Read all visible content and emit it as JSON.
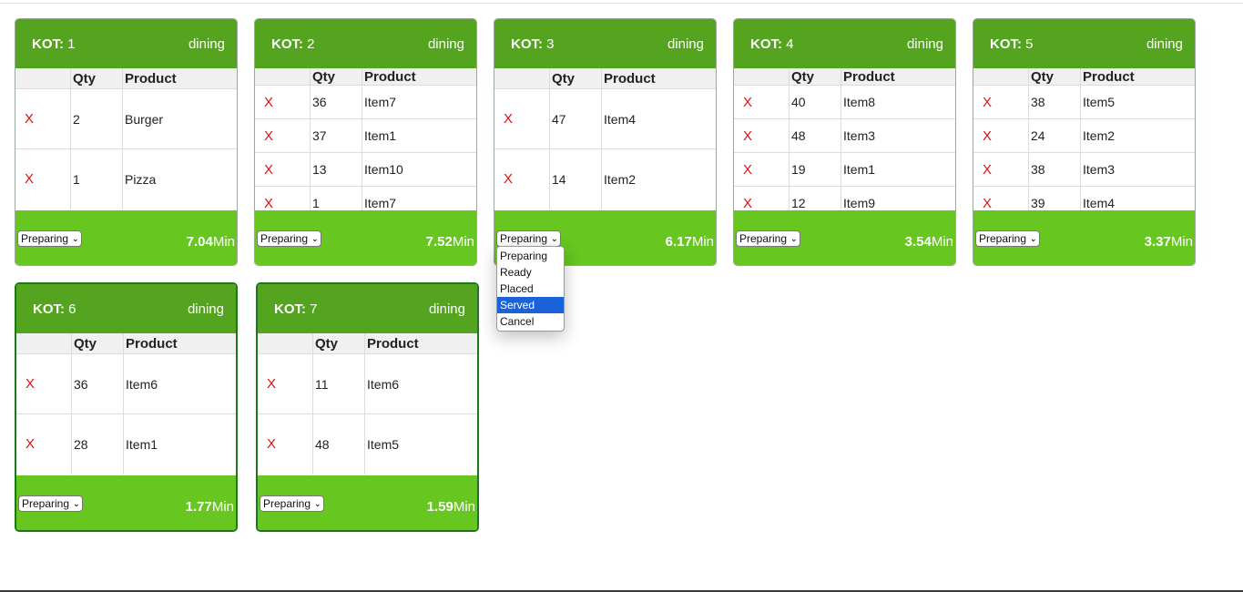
{
  "kot_label": "KOT:",
  "columns": {
    "qty": "Qty",
    "product": "Product"
  },
  "remove_symbol": "X",
  "minute_unit": "Min",
  "cards": [
    {
      "number": "1",
      "type": "dining",
      "status": "Preparing",
      "time": "7.04",
      "items": [
        {
          "qty": "2",
          "product": "Burger"
        },
        {
          "qty": "1",
          "product": "Pizza"
        }
      ]
    },
    {
      "number": "2",
      "type": "dining",
      "status": "Preparing",
      "time": "7.52",
      "items": [
        {
          "qty": "36",
          "product": "Item7"
        },
        {
          "qty": "37",
          "product": "Item1"
        },
        {
          "qty": "13",
          "product": "Item10"
        },
        {
          "qty": "1",
          "product": "Item7"
        }
      ]
    },
    {
      "number": "3",
      "type": "dining",
      "status": "Preparing",
      "time": "6.17",
      "items": [
        {
          "qty": "47",
          "product": "Item4"
        },
        {
          "qty": "14",
          "product": "Item2"
        }
      ]
    },
    {
      "number": "4",
      "type": "dining",
      "status": "Preparing",
      "time": "3.54",
      "items": [
        {
          "qty": "40",
          "product": "Item8"
        },
        {
          "qty": "48",
          "product": "Item3"
        },
        {
          "qty": "19",
          "product": "Item1"
        },
        {
          "qty": "12",
          "product": "Item9"
        }
      ]
    },
    {
      "number": "5",
      "type": "dining",
      "status": "Preparing",
      "time": "3.37",
      "items": [
        {
          "qty": "38",
          "product": "Item5"
        },
        {
          "qty": "24",
          "product": "Item2"
        },
        {
          "qty": "38",
          "product": "Item3"
        },
        {
          "qty": "39",
          "product": "Item4"
        }
      ]
    },
    {
      "number": "6",
      "type": "dining",
      "status": "Preparing",
      "time": "1.77",
      "items": [
        {
          "qty": "36",
          "product": "Item6"
        },
        {
          "qty": "28",
          "product": "Item1"
        }
      ]
    },
    {
      "number": "7",
      "type": "dining",
      "status": "Preparing",
      "time": "1.59",
      "items": [
        {
          "qty": "11",
          "product": "Item6"
        },
        {
          "qty": "48",
          "product": "Item5"
        }
      ]
    }
  ],
  "status_dropdown": {
    "open_on_card": "3",
    "options": [
      "Preparing",
      "Ready",
      "Placed",
      "Served",
      "Cancel"
    ],
    "highlighted": "Served"
  },
  "colors": {
    "header": "#55a41f",
    "footer": "#67c61f",
    "remove": "#e01010",
    "highlight": "#1a62d8"
  }
}
